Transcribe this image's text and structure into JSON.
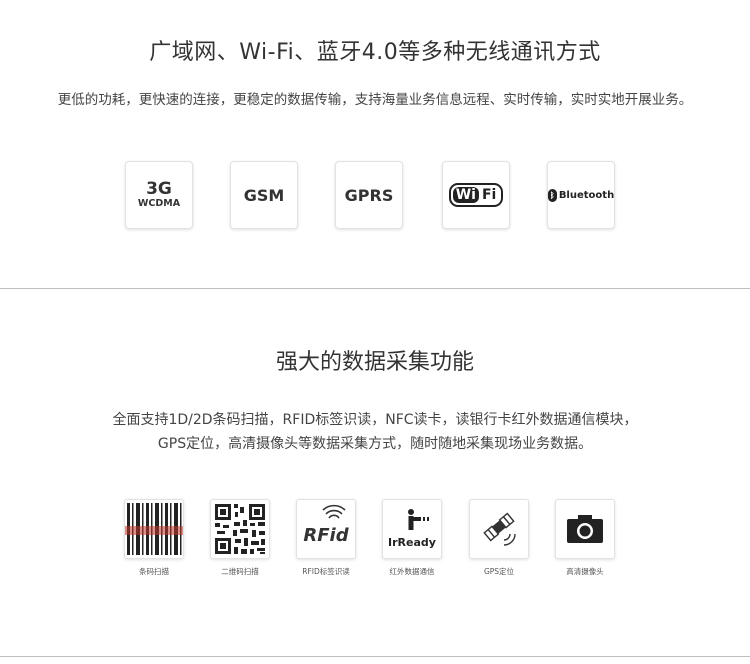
{
  "section1": {
    "title": "广域网、Wi-Fi、蓝牙4.0等多种无线通讯方式",
    "subtitle": "更低的功耗，更快速的连接，更稳定的数据传输，支持海量业务信息远程、实时传输，实时实地开展业务。",
    "cards": {
      "card_3g_main": "3G",
      "card_3g_sub": "WCDMA",
      "card_gsm": "GSM",
      "card_gprs": "GPRS",
      "wifi_left": "Wi",
      "wifi_right": "Fi",
      "bluetooth": "Bluetooth"
    }
  },
  "section2": {
    "title": "强大的数据采集功能",
    "line1": "全面支持1D/2D条码扫描，RFID标签识读，NFC读卡，读银行卡红外数据通信模块，",
    "line2": "GPS定位，高清摄像头等数据采集方式，随时随地采集现场业务数据。",
    "rfid_text": "RFid",
    "irready_text": "IrReady",
    "captions": [
      "条码扫描",
      "二维码扫描",
      "RFID标签识读",
      "红外数据通信",
      "GPS定位",
      "高清摄像头"
    ]
  },
  "colors": {
    "divider": "#bdbdbd",
    "text": "#333333",
    "barcode_red": "#c0392b"
  }
}
